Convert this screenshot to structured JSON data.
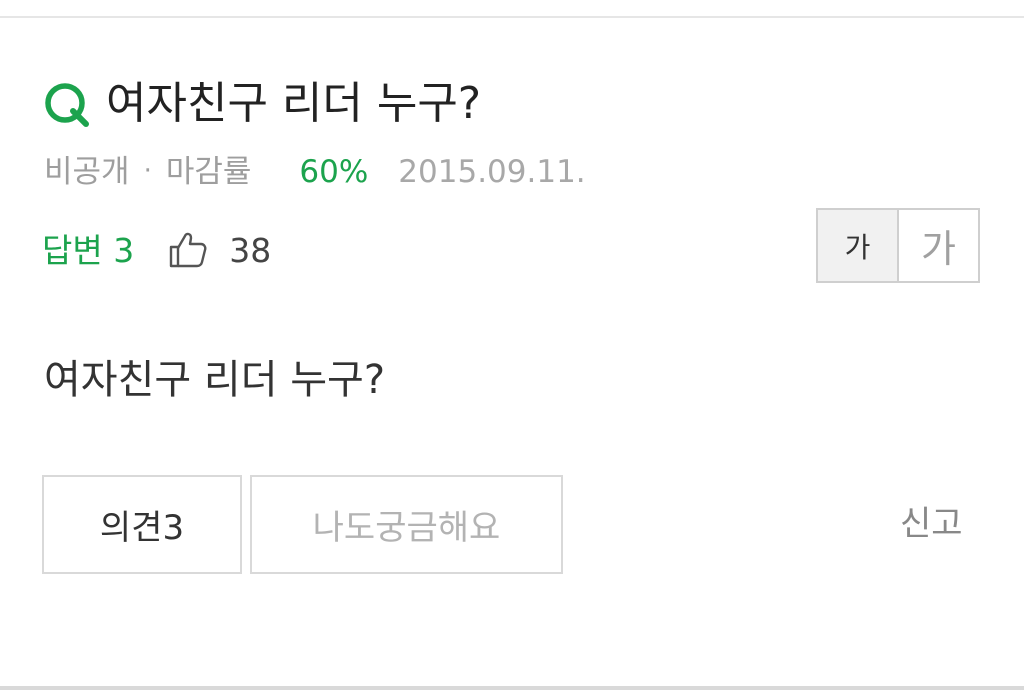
{
  "question": {
    "icon": "q-icon",
    "title": "여자친구 리더 누구?",
    "body": "여자친구 리더 누구?"
  },
  "meta": {
    "visibility": "비공개",
    "separator": "·",
    "closing_rate_label": "마감률",
    "closing_rate_value": "60%",
    "date": "2015.09.11."
  },
  "stats": {
    "answer_label": "답변 3",
    "like_icon": "thumbs-up-icon",
    "like_count": "38"
  },
  "font_toggle": {
    "small_label": "가",
    "large_label": "가"
  },
  "actions": {
    "opinion_label": "의견3",
    "curious_label": "나도궁금해요",
    "report_label": "신고"
  },
  "colors": {
    "accent_green": "#1ca34d",
    "muted_gray": "#9e9e9e",
    "border_gray": "#d9d9d9"
  }
}
